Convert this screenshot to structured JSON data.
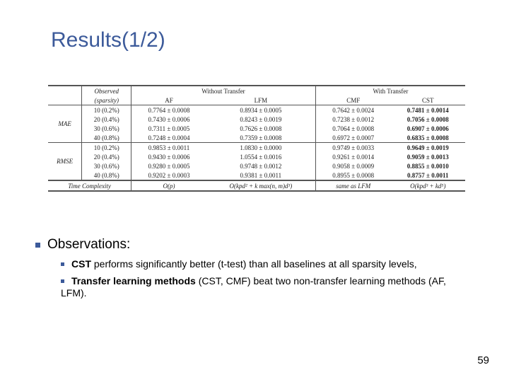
{
  "title": "Results(1/2)",
  "table": {
    "h1": {
      "obs": "Observed",
      "spar": "(sparsity)",
      "wot": "Without Transfer",
      "wt": "With Transfer"
    },
    "h2": {
      "af": "AF",
      "lfm": "LFM",
      "cmf": "CMF",
      "cst": "CST"
    },
    "metrics": {
      "mae": "MAE",
      "rmse": "RMSE"
    },
    "levels": [
      "10 (0.2%)",
      "20 (0.4%)",
      "30 (0.6%)",
      "40 (0.8%)"
    ],
    "mae": {
      "af": [
        "0.7764 ± 0.0008",
        "0.7430 ± 0.0006",
        "0.7311 ± 0.0005",
        "0.7248 ± 0.0004"
      ],
      "lfm": [
        "0.8934 ± 0.0005",
        "0.8243 ± 0.0019",
        "0.7626 ± 0.0008",
        "0.7359 ± 0.0008"
      ],
      "cmf": [
        "0.7642 ± 0.0024",
        "0.7238 ± 0.0012",
        "0.7064 ± 0.0008",
        "0.6972 ± 0.0007"
      ],
      "cst": [
        "0.7481 ± 0.0014",
        "0.7056 ± 0.0008",
        "0.6907 ± 0.0006",
        "0.6835 ± 0.0008"
      ]
    },
    "rmse": {
      "af": [
        "0.9853 ± 0.0011",
        "0.9430 ± 0.0006",
        "0.9280 ± 0.0005",
        "0.9202 ± 0.0003"
      ],
      "lfm": [
        "1.0830 ± 0.0000",
        "1.0554 ± 0.0016",
        "0.9748 ± 0.0012",
        "0.9381 ± 0.0011"
      ],
      "cmf": [
        "0.9749 ± 0.0033",
        "0.9261 ± 0.0014",
        "0.9058 ± 0.0009",
        "0.8955 ± 0.0008"
      ],
      "cst": [
        "0.9649 ± 0.0019",
        "0.9059 ± 0.0013",
        "0.8855 ± 0.0010",
        "0.8757 ± 0.0011"
      ]
    },
    "tc": {
      "label": "Time Complexity",
      "af": "O(p)",
      "lfm": "O(kpd² + k max(n, m)d³)",
      "cmf": "same as LFM",
      "cst": "O(kpd³ + kd⁵)"
    }
  },
  "obs": {
    "heading": "Observations:",
    "b1a": "CST",
    "b1b": " performs significantly better (t-test) than all baselines at all sparsity levels,",
    "b2a": "Transfer learning methods",
    "b2b": " (CST, CMF) beat two non-transfer learning methods (AF, LFM)."
  },
  "pagenum": "59"
}
